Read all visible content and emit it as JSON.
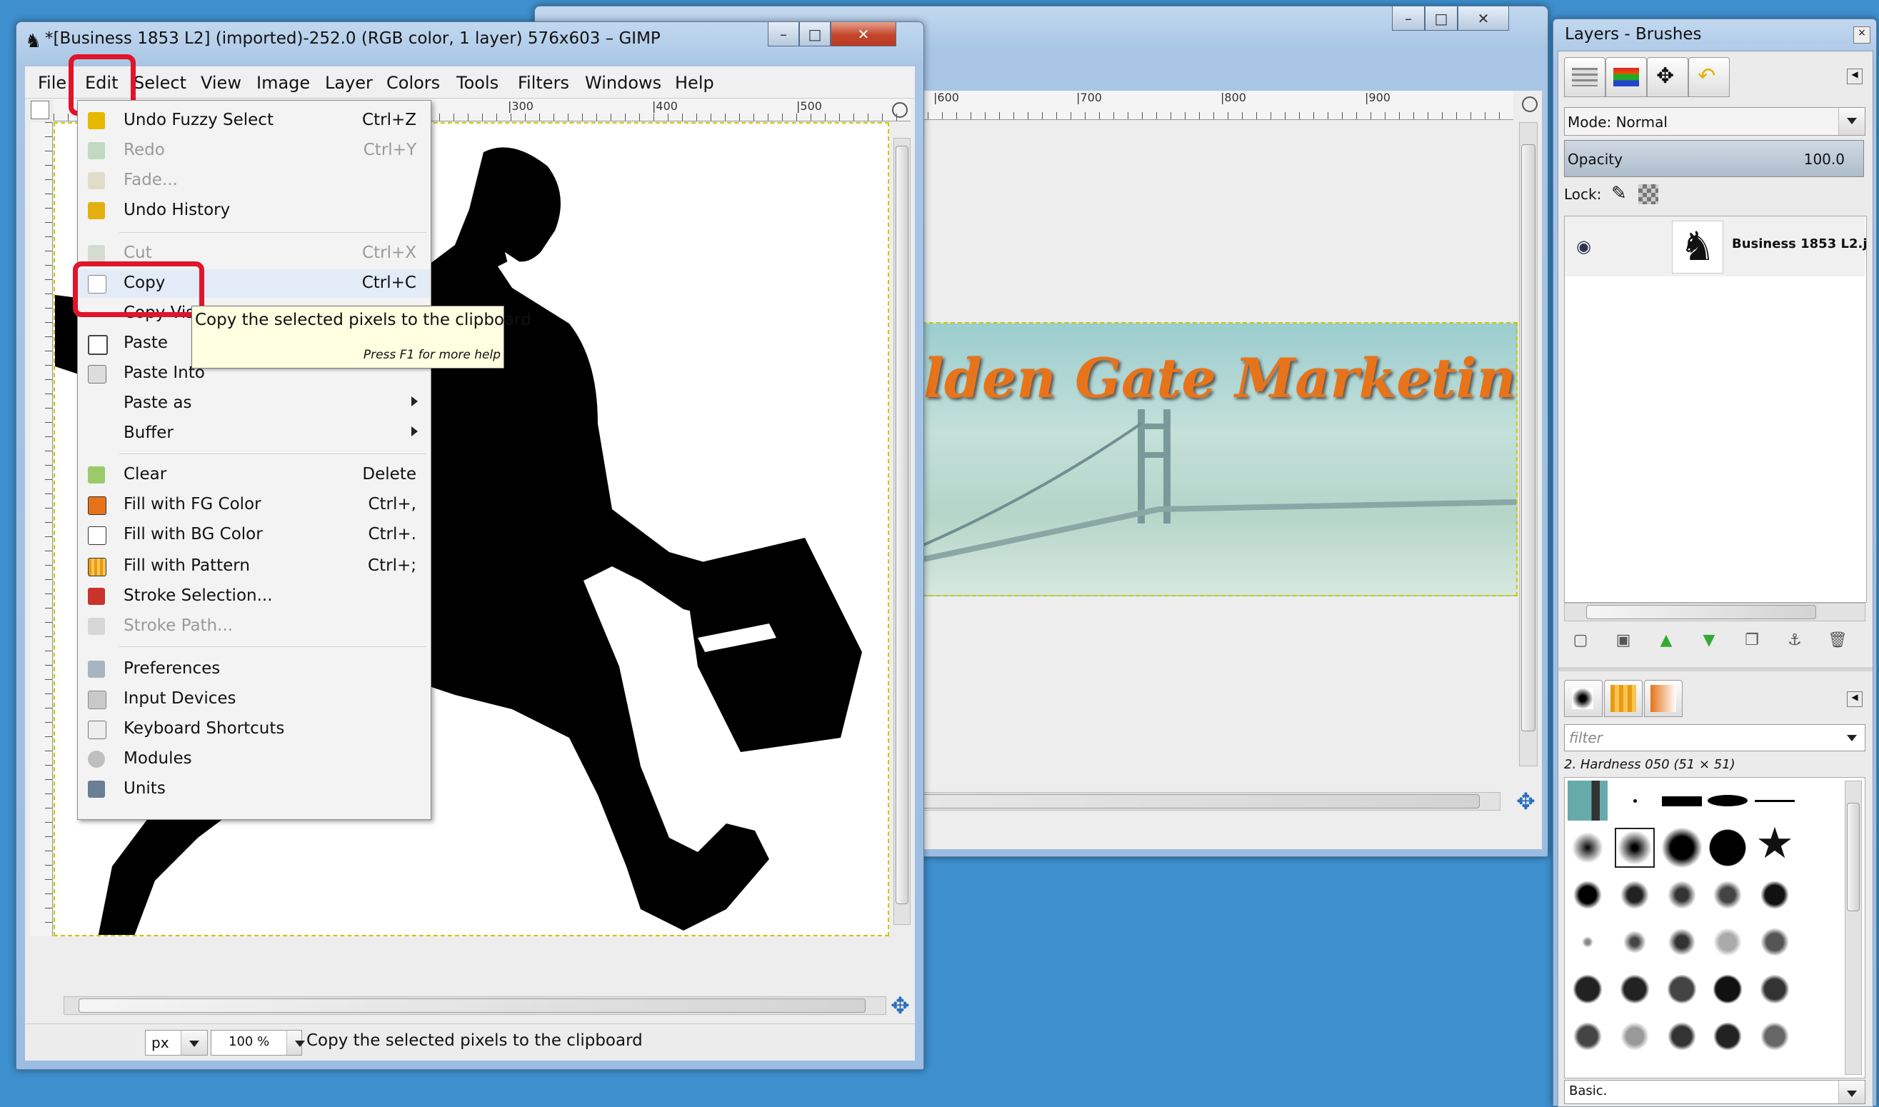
{
  "back_window": {
    "title": "",
    "caption_min": "–",
    "caption_max": "□",
    "caption_close": "✕"
  },
  "banner": {
    "text": "lden Gate Marketing"
  },
  "ruler_top_back": [
    "|600",
    "|700",
    "|800",
    "|900"
  ],
  "gimp_window": {
    "title": "*[Business 1853 L2] (imported)-252.0 (RGB color, 1 layer) 576x603 – GIMP",
    "menu": [
      "File",
      "Edit",
      "Select",
      "View",
      "Image",
      "Layer",
      "Colors",
      "Tools",
      "Filters",
      "Windows",
      "Help"
    ],
    "ruler_top": [
      "|300",
      "|400",
      "|500"
    ],
    "status": {
      "unit": "px",
      "zoom": "100 %",
      "message": "Copy the selected pixels to the clipboard"
    }
  },
  "edit_menu": {
    "items": [
      {
        "label": "Undo Fuzzy Select",
        "shortcut": "Ctrl+Z",
        "icon": "undo-icon",
        "disabled": false
      },
      {
        "label": "Redo",
        "shortcut": "Ctrl+Y",
        "icon": "redo-icon",
        "disabled": true
      },
      {
        "label": "Fade...",
        "shortcut": "",
        "icon": "fade-icon",
        "disabled": true
      },
      {
        "label": "Undo History",
        "shortcut": "",
        "icon": "undo-history-icon",
        "disabled": false
      },
      {
        "label": "Cut",
        "shortcut": "Ctrl+X",
        "icon": "scissors-icon",
        "disabled": true
      },
      {
        "label": "Copy",
        "shortcut": "Ctrl+C",
        "icon": "copy-icon",
        "disabled": false
      },
      {
        "label": "Copy Vis",
        "shortcut": "",
        "icon": "",
        "disabled": false
      },
      {
        "label": "Paste",
        "shortcut": "",
        "icon": "paste-icon",
        "disabled": false
      },
      {
        "label": "Paste Into",
        "shortcut": "",
        "icon": "paste-into-icon",
        "disabled": false
      },
      {
        "label": "Paste as",
        "shortcut": "",
        "icon": "",
        "disabled": false,
        "submenu": true
      },
      {
        "label": "Buffer",
        "shortcut": "",
        "icon": "",
        "disabled": false,
        "submenu": true
      },
      {
        "label": "Clear",
        "shortcut": "Delete",
        "icon": "clear-icon",
        "disabled": false
      },
      {
        "label": "Fill with FG Color",
        "shortcut": "Ctrl+,",
        "icon": "fg-color-icon",
        "disabled": false
      },
      {
        "label": "Fill with BG Color",
        "shortcut": "Ctrl+.",
        "icon": "bg-color-icon",
        "disabled": false
      },
      {
        "label": "Fill with Pattern",
        "shortcut": "Ctrl+;",
        "icon": "pattern-icon",
        "disabled": false
      },
      {
        "label": "Stroke Selection...",
        "shortcut": "",
        "icon": "stroke-selection-icon",
        "disabled": false
      },
      {
        "label": "Stroke Path...",
        "shortcut": "",
        "icon": "stroke-path-icon",
        "disabled": true
      },
      {
        "label": "Preferences",
        "shortcut": "",
        "icon": "preferences-icon",
        "disabled": false
      },
      {
        "label": "Input Devices",
        "shortcut": "",
        "icon": "input-devices-icon",
        "disabled": false
      },
      {
        "label": "Keyboard Shortcuts",
        "shortcut": "",
        "icon": "keyboard-icon",
        "disabled": false
      },
      {
        "label": "Modules",
        "shortcut": "",
        "icon": "modules-icon",
        "disabled": false
      },
      {
        "label": "Units",
        "shortcut": "",
        "icon": "units-icon",
        "disabled": false
      }
    ]
  },
  "tooltip": {
    "main": "Copy the selected pixels to the clipboard",
    "hint": "Press F1 for more help"
  },
  "dock": {
    "title": "Layers - Brushes",
    "mode_label": "Mode: Normal",
    "opacity_label": "Opacity",
    "opacity_value": "100.0",
    "lock_label": "Lock:",
    "layer_name": "Business 1853 L2.j",
    "filter_placeholder": "filter",
    "brush_name": "2. Hardness 050 (51 × 51)",
    "preset": "Basic."
  },
  "colors": {
    "accent_red": "#e0142a",
    "banner_text": "#e7741a",
    "desktop": "#3d8fcd",
    "tooltip_bg": "#ffffe1"
  }
}
